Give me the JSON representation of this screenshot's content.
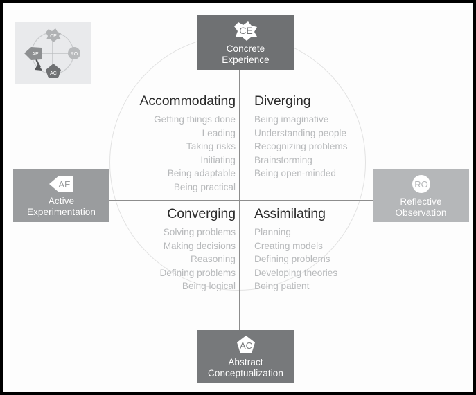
{
  "diagram": {
    "title": "Kolb Learning Styles Cycle",
    "poles": [
      {
        "id": "ce",
        "abbr": "CE",
        "label": "Concrete\nExperience",
        "icon": "splat-burst-icon",
        "color": "#6f7173",
        "position": "top"
      },
      {
        "id": "ro",
        "abbr": "RO",
        "label": "Reflective\nObservation",
        "icon": "circle-icon",
        "color": "#b5b7b9",
        "position": "right"
      },
      {
        "id": "ac",
        "abbr": "AC",
        "label": "Abstract\nConceptualization",
        "icon": "pentagon-icon",
        "color": "#77797b",
        "position": "bottom"
      },
      {
        "id": "ae",
        "abbr": "AE",
        "label": "Active\nExperimentation",
        "icon": "left-arrow-icon",
        "color": "#9a9c9e",
        "position": "left"
      }
    ],
    "quadrants": [
      {
        "id": "accommodating",
        "heading": "Accommodating",
        "align": "right",
        "items": [
          "Getting things done",
          "Leading",
          "Taking risks",
          "Initiating",
          "Being adaptable",
          "Being practical"
        ]
      },
      {
        "id": "diverging",
        "heading": "Diverging",
        "align": "left",
        "items": [
          "Being imaginative",
          "Understanding people",
          "Recognizing problems",
          "Brainstorming",
          "Being open-minded"
        ]
      },
      {
        "id": "converging",
        "heading": "Converging",
        "align": "right",
        "items": [
          "Solving problems",
          "Making decisions",
          "Reasoning",
          "Defining problems",
          "Being logical"
        ]
      },
      {
        "id": "assimilating",
        "heading": "Assimilating",
        "align": "left",
        "items": [
          "Planning",
          "Creating models",
          "Defining problems",
          "Developing theories",
          "Being patient"
        ]
      }
    ],
    "thumbnail": {
      "abbrs": [
        "CE",
        "RO",
        "AC",
        "AE"
      ],
      "background": "#e9eaec"
    },
    "colors": {
      "axis": "#8d8d8d",
      "circle": "#e2e2e2",
      "heading_text": "#2b2b2b",
      "item_text": "#b7b9bb",
      "frame": "#000000",
      "page_background": "#ffffff"
    }
  }
}
